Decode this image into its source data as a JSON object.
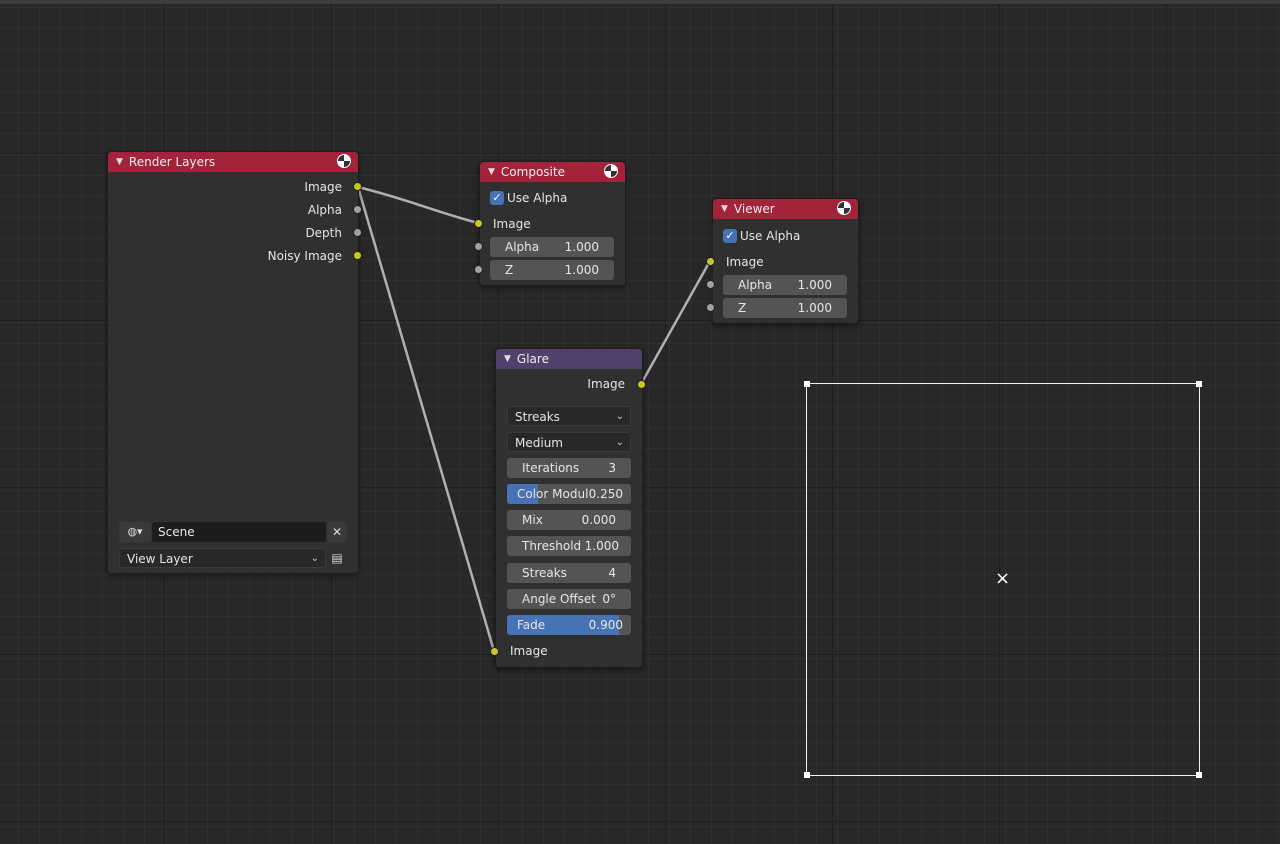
{
  "render_layers": {
    "title": "Render Layers",
    "outputs": [
      "Image",
      "Alpha",
      "Depth",
      "Noisy Image"
    ],
    "scene": "Scene",
    "view_layer": "View Layer"
  },
  "composite": {
    "title": "Composite",
    "use_alpha_label": "Use Alpha",
    "image_label": "Image",
    "alpha_label": "Alpha",
    "alpha_value": "1.000",
    "z_label": "Z",
    "z_value": "1.000"
  },
  "viewer": {
    "title": "Viewer",
    "use_alpha_label": "Use Alpha",
    "image_label": "Image",
    "alpha_label": "Alpha",
    "alpha_value": "1.000",
    "z_label": "Z",
    "z_value": "1.000"
  },
  "glare": {
    "title": "Glare",
    "output_label": "Image",
    "type": "Streaks",
    "quality": "Medium",
    "iterations_label": "Iterations",
    "iterations_value": "3",
    "color_mod_label": "Color Modul",
    "color_mod_value": "0.250",
    "color_mod_fraction": 0.25,
    "mix_label": "Mix",
    "mix_value": "0.000",
    "threshold_label": "Threshold",
    "threshold_value": "1.000",
    "streaks_label": "Streaks",
    "streaks_value": "4",
    "angle_label": "Angle Offset",
    "angle_value": "0°",
    "fade_label": "Fade",
    "fade_value": "0.900",
    "fade_fraction": 0.9,
    "input_label": "Image"
  },
  "colors": {
    "header_red": "#a3233b",
    "header_purple": "#50406b",
    "socket_yellow": "#c7c729",
    "socket_grey": "#a1a1a1",
    "accent_blue": "#4772b3"
  }
}
